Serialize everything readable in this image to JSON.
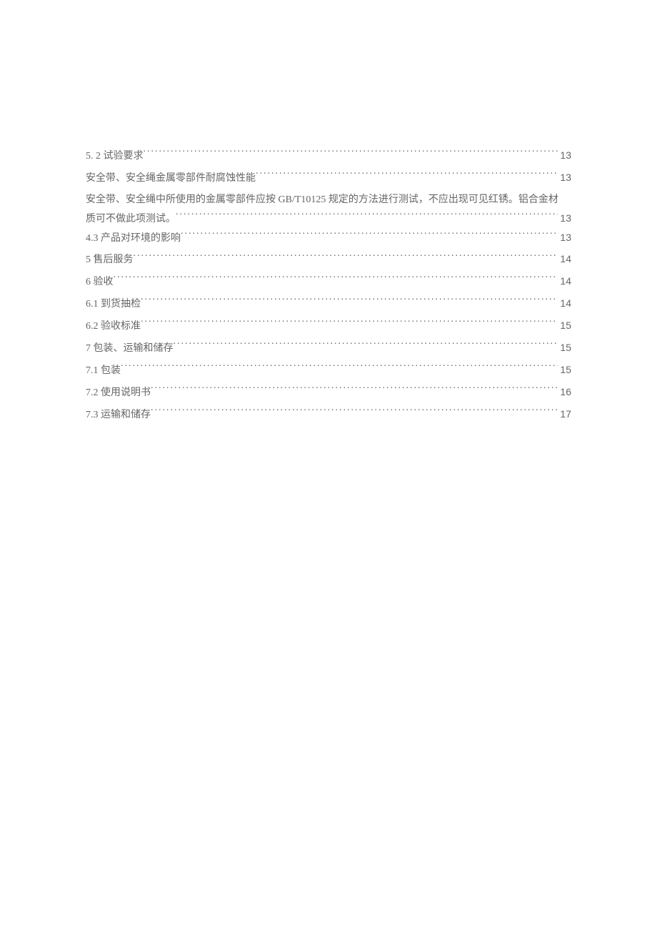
{
  "entries": [
    {
      "title": "5.  2 试验要求",
      "page": "13",
      "type": "single"
    },
    {
      "title": "安全带、安全绳金属零部件耐腐蚀性能",
      "page": "13",
      "type": "single"
    },
    {
      "line1": "安全带、安全绳中所使用的金属零部件应按 GB/T10125 规定的方法进行测试，不应出现可见红锈。铝合金材",
      "line2": "质可不做此项测试。",
      "page": "13",
      "type": "multi"
    },
    {
      "title": "4.3 产品对环境的影响",
      "page": "13",
      "type": "single"
    },
    {
      "title": "5 售后服务",
      "page": "14",
      "type": "single"
    },
    {
      "title": "6 验收",
      "page": "14",
      "type": "single"
    },
    {
      "title": "6.1 到货抽检",
      "page": "14",
      "type": "single"
    },
    {
      "title": "6.2 验收标准",
      "page": "15",
      "type": "single"
    },
    {
      "title": "7 包装、运输和储存",
      "page": "15",
      "type": "single"
    },
    {
      "title": "7.1 包装",
      "page": "15",
      "type": "single"
    },
    {
      "title": "7.2 使用说明书",
      "page": "16",
      "type": "single"
    },
    {
      "title": "7.3 运输和储存",
      "page": "17",
      "type": "single"
    }
  ]
}
